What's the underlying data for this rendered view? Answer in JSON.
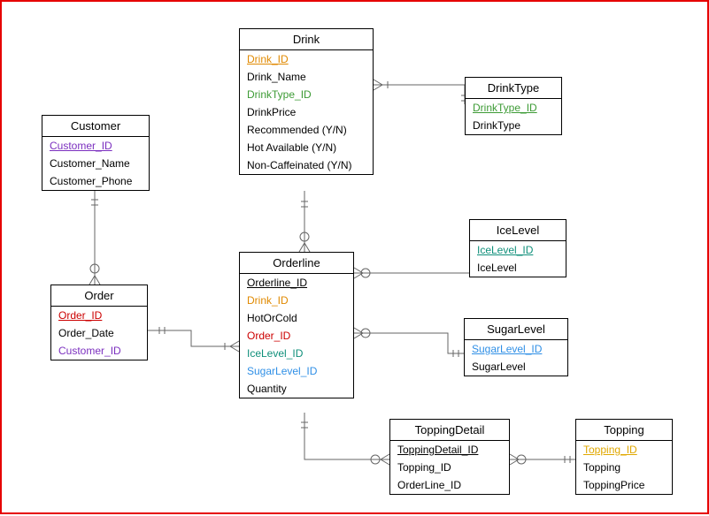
{
  "entities": {
    "customer": {
      "title": "Customer",
      "attrs": [
        {
          "text": "Customer_ID",
          "color": "#7b2fbf",
          "underline": true
        },
        {
          "text": "Customer_Name",
          "color": "#000000",
          "underline": false
        },
        {
          "text": "Customer_Phone",
          "color": "#000000",
          "underline": false
        }
      ]
    },
    "drink": {
      "title": "Drink",
      "attrs": [
        {
          "text": "Drink_ID",
          "color": "#e08900",
          "underline": true
        },
        {
          "text": "Drink_Name",
          "color": "#000000",
          "underline": false
        },
        {
          "text": "DrinkType_ID",
          "color": "#3d9b35",
          "underline": false
        },
        {
          "text": "DrinkPrice",
          "color": "#000000",
          "underline": false
        },
        {
          "text": "Recommended (Y/N)",
          "color": "#000000",
          "underline": false
        },
        {
          "text": "Hot Available (Y/N)",
          "color": "#000000",
          "underline": false
        },
        {
          "text": "Non-Caffeinated (Y/N)",
          "color": "#000000",
          "underline": false
        }
      ]
    },
    "drinktype": {
      "title": "DrinkType",
      "attrs": [
        {
          "text": "DrinkType_ID",
          "color": "#3d9b35",
          "underline": true
        },
        {
          "text": "DrinkType",
          "color": "#000000",
          "underline": false
        }
      ]
    },
    "order": {
      "title": "Order",
      "attrs": [
        {
          "text": "Order_ID",
          "color": "#cc0000",
          "underline": true
        },
        {
          "text": "Order_Date",
          "color": "#000000",
          "underline": false
        },
        {
          "text": "Customer_ID",
          "color": "#7b2fbf",
          "underline": false
        }
      ]
    },
    "orderline": {
      "title": "Orderline",
      "attrs": [
        {
          "text": "Orderline_ID",
          "color": "#000000",
          "underline": true
        },
        {
          "text": "Drink_ID",
          "color": "#e08900",
          "underline": false
        },
        {
          "text": "HotOrCold",
          "color": "#000000",
          "underline": false
        },
        {
          "text": "Order_ID",
          "color": "#cc0000",
          "underline": false
        },
        {
          "text": "IceLevel_ID",
          "color": "#0f8f7a",
          "underline": false
        },
        {
          "text": "SugarLevel_ID",
          "color": "#2f8fe6",
          "underline": false
        },
        {
          "text": "Quantity",
          "color": "#000000",
          "underline": false
        }
      ]
    },
    "icelevel": {
      "title": "IceLevel",
      "attrs": [
        {
          "text": "IceLevel_ID",
          "color": "#0f8f7a",
          "underline": true
        },
        {
          "text": "IceLevel",
          "color": "#000000",
          "underline": false
        }
      ]
    },
    "sugarlevel": {
      "title": "SugarLevel",
      "attrs": [
        {
          "text": "SugarLevel_ID",
          "color": "#2f8fe6",
          "underline": true
        },
        {
          "text": "SugarLevel",
          "color": "#000000",
          "underline": false
        }
      ]
    },
    "toppingdetail": {
      "title": "ToppingDetail",
      "attrs": [
        {
          "text": "ToppingDetail_ID",
          "color": "#000000",
          "underline": true
        },
        {
          "text": "Topping_ID",
          "color": "#000000",
          "underline": false
        },
        {
          "text": "OrderLine_ID",
          "color": "#000000",
          "underline": false
        }
      ]
    },
    "topping": {
      "title": "Topping",
      "attrs": [
        {
          "text": "Topping_ID",
          "color": "#e0a800",
          "underline": true
        },
        {
          "text": "Topping",
          "color": "#000000",
          "underline": false
        },
        {
          "text": "ToppingPrice",
          "color": "#000000",
          "underline": false
        }
      ]
    }
  },
  "relationships": [
    {
      "from": "Customer",
      "to": "Order",
      "from_card": "one-mandatory",
      "to_card": "many-optional"
    },
    {
      "from": "Order",
      "to": "Orderline",
      "from_card": "one-mandatory",
      "to_card": "many-mandatory"
    },
    {
      "from": "Drink",
      "to": "Orderline",
      "from_card": "one-mandatory",
      "to_card": "many-optional"
    },
    {
      "from": "Drink",
      "to": "DrinkType",
      "from_card": "many-mandatory",
      "to_card": "one-mandatory"
    },
    {
      "from": "Orderline",
      "to": "IceLevel",
      "from_card": "many-optional",
      "to_card": "one-mandatory"
    },
    {
      "from": "Orderline",
      "to": "SugarLevel",
      "from_card": "many-optional",
      "to_card": "one-mandatory"
    },
    {
      "from": "Orderline",
      "to": "ToppingDetail",
      "from_card": "one-mandatory",
      "to_card": "many-optional"
    },
    {
      "from": "ToppingDetail",
      "to": "Topping",
      "from_card": "many-optional",
      "to_card": "one-mandatory"
    }
  ]
}
